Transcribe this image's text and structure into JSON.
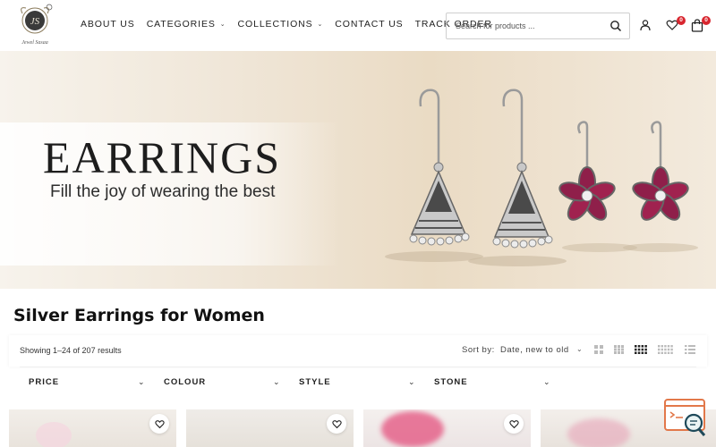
{
  "header": {
    "logo_text": "Jewel Sasaa",
    "nav": [
      {
        "label": "ABOUT US",
        "has_dropdown": false
      },
      {
        "label": "CATEGORIES",
        "has_dropdown": true
      },
      {
        "label": "COLLECTIONS",
        "has_dropdown": true
      },
      {
        "label": "CONTACT US",
        "has_dropdown": false
      },
      {
        "label": "TRACK ORDER",
        "has_dropdown": false
      }
    ],
    "search": {
      "placeholder": "Search for products ...",
      "icon": "search-icon"
    },
    "account_icon": "user-icon",
    "wishlist": {
      "icon": "heart-icon",
      "count": "0"
    },
    "cart": {
      "icon": "shopping-bag-icon",
      "count": "0"
    },
    "badge_color": "#d8262f"
  },
  "banner": {
    "title": "EARRINGS",
    "subtitle": "Fill the joy of wearing the best"
  },
  "page": {
    "title": "Silver Earrings for Women"
  },
  "toolbar": {
    "results": "Showing 1–24 of 207 results",
    "sort_label": "Sort by:",
    "sort_value": "Date, new to old",
    "active_grid": "grid-4"
  },
  "filters": [
    {
      "label": "PRICE"
    },
    {
      "label": "COLOUR"
    },
    {
      "label": "STYLE"
    },
    {
      "label": "STONE"
    }
  ]
}
